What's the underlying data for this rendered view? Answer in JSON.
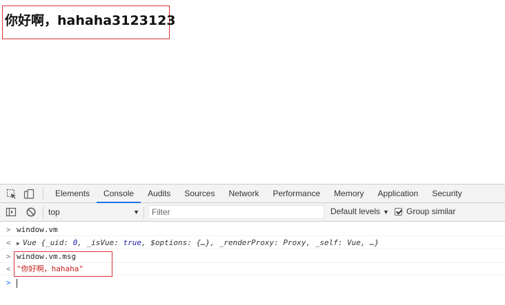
{
  "page": {
    "heading": "你好啊，hahaha3123123"
  },
  "devtools": {
    "tabs": [
      {
        "label": "Elements",
        "active": false
      },
      {
        "label": "Console",
        "active": true
      },
      {
        "label": "Audits",
        "active": false
      },
      {
        "label": "Sources",
        "active": false
      },
      {
        "label": "Network",
        "active": false
      },
      {
        "label": "Performance",
        "active": false
      },
      {
        "label": "Memory",
        "active": false
      },
      {
        "label": "Application",
        "active": false
      },
      {
        "label": "Security",
        "active": false
      }
    ],
    "toolbar": {
      "context": "top",
      "filter_placeholder": "Filter",
      "levels_label": "Default levels",
      "group_similar_label": "Group similar",
      "group_similar_checked": true
    },
    "console": {
      "entries": [
        {
          "type": "input",
          "prompt": ">",
          "text": "window.vm"
        },
        {
          "type": "output",
          "prompt": "<",
          "text_plain_prefix": "Vue {_uid: ",
          "uid": "0",
          "mid1": ", _isVue: ",
          "isvue": "true",
          "rest": ", $options: {…}, _renderProxy: Proxy, _self: Vue, …}"
        },
        {
          "type": "input",
          "prompt": ">",
          "text": "window.vm.msg"
        },
        {
          "type": "output",
          "prompt": "<",
          "text": "\"你好啊，hahaha\""
        }
      ],
      "prompt_symbol": ">"
    },
    "colors": {
      "highlight_border": "#d9302f",
      "active_tab_underline": "#1a73e8",
      "string_color": "#c41a16",
      "keyword_color": "#1a1aa6"
    }
  }
}
